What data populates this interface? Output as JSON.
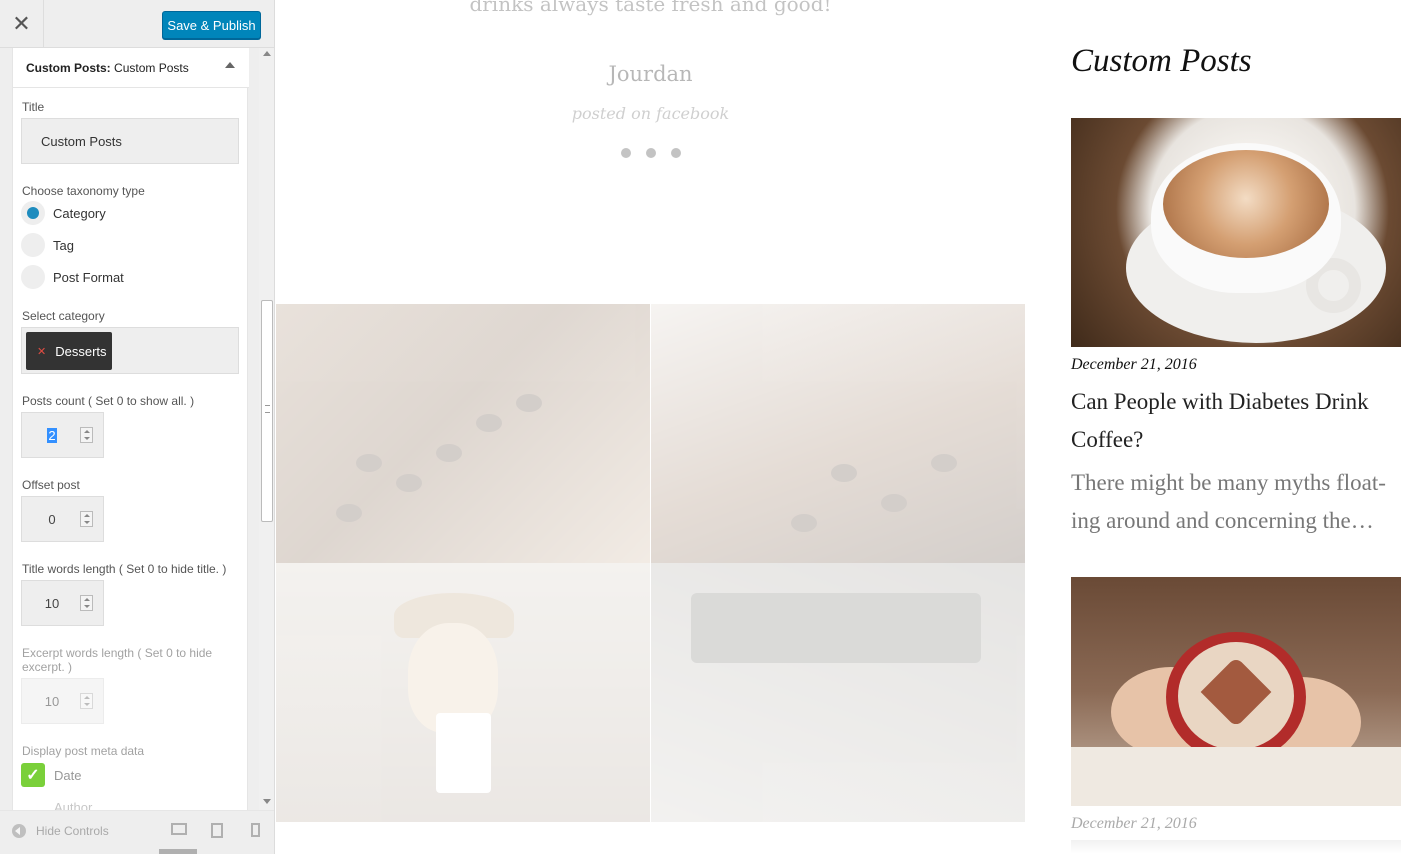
{
  "header": {
    "close_icon": "close-icon",
    "save_label": "Save & Publish"
  },
  "widget": {
    "type_label": "Custom Posts:",
    "instance_label": "Custom Posts",
    "fields": {
      "title_label": "Title",
      "title_value": "Custom Posts",
      "taxonomy_label": "Choose taxonomy type",
      "taxonomy_options": [
        "Category",
        "Tag",
        "Post Format"
      ],
      "taxonomy_selected": "Category",
      "category_label": "Select category",
      "category_selected": "Desserts",
      "posts_count_label": "Posts count ( Set 0 to show all. )",
      "posts_count_value": "2",
      "offset_label": "Offset post",
      "offset_value": "0",
      "title_words_label": "Title words length ( Set 0 to hide title. )",
      "title_words_value": "10",
      "excerpt_words_label": "Excerpt words length ( Set 0 to hide excerpt. )",
      "excerpt_words_value": "10",
      "meta_label": "Display post meta data",
      "meta_options": [
        "Date",
        "Author"
      ]
    }
  },
  "footer": {
    "hide_controls": "Hide Controls",
    "devices": [
      "desktop-icon",
      "tablet-icon",
      "mobile-icon"
    ]
  },
  "preview": {
    "testimonial": {
      "quote": "drinks always taste fresh and good!",
      "author": "Jourdan",
      "source": "posted on facebook"
    },
    "widget_title": "Custom Posts",
    "posts": [
      {
        "date": "December 21, 2016",
        "title": "Can People with Diabetes Drink Coffee?",
        "excerpt": "There might be many myths float-ing around and concerning the…"
      },
      {
        "date": "December 21, 2016"
      }
    ]
  },
  "colors": {
    "primary_button": "#0085ba",
    "radio_selected": "#1e8cbe",
    "checkbox_checked": "#7ad03a",
    "chip_bg": "#333333"
  }
}
